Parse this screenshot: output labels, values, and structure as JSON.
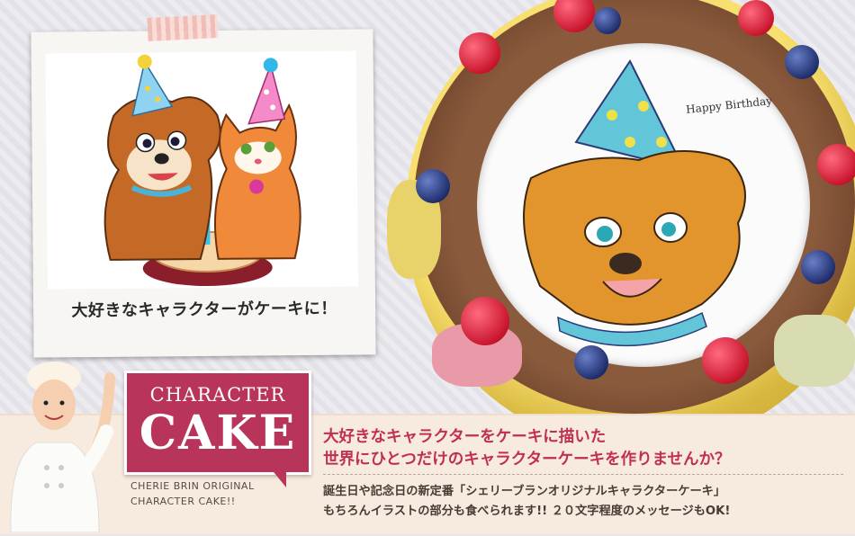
{
  "polaroid": {
    "caption": "大好きなキャラクターがケーキに！"
  },
  "cake": {
    "message": "Happy Birthday"
  },
  "badge": {
    "top": "CHARACTER",
    "main": "CAKE"
  },
  "subtitle": {
    "line1": "CHERIE BRIN ORIGINAL",
    "line2": "CHARACTER CAKE!!"
  },
  "headline": {
    "line1": "大好きなキャラクターをケーキに描いた",
    "line2": "世界にひとつだけのキャラクターケーキを作りませんか？"
  },
  "body": {
    "line1": "誕生日や記念日の新定番「シェリーブランオリジナルキャラクターケーキ」",
    "line2": "もちろんイラストの部分も食べられます!! ２０文字程度のメッセージもOK!"
  },
  "colors": {
    "accent": "#b8345a",
    "headline": "#c0304f",
    "band": "#f7ebe0"
  },
  "icons": [
    "chef-illustration",
    "dog-illustration",
    "cat-illustration",
    "party-hat-icon",
    "birthday-cake-illustration"
  ]
}
